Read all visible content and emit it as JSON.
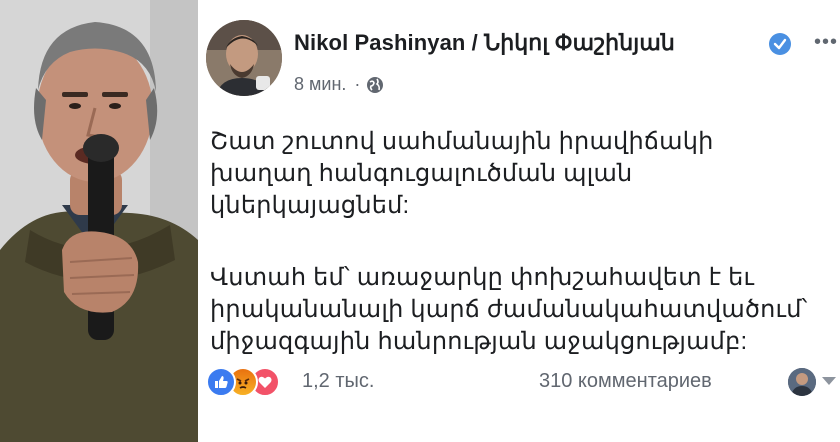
{
  "post": {
    "author": "Nikol Pashinyan / Նիկոլ Փաշինյան",
    "time": "8 мин.",
    "separator": "·",
    "menu": "•••",
    "paragraph1": [
      "Շատ շուտով սահմանային իրավիճակի",
      "խաղաղ հանգուցալուծման պլան",
      "կներկայացնեմ:"
    ],
    "paragraph2": [
      "Վստահ եմ՝ առաջարկը փոխշահավետ է եւ",
      "իրականանալի կարճ ժամանակահատվածում՝",
      "միջազգային հանրության աջակցությամբ:"
    ],
    "reactions_count": "1,2 тыс.",
    "comments_count": "310 комментариев"
  },
  "icons": {
    "verified": "verified-badge-icon",
    "audience": "globe-icon",
    "reactions": [
      "like-icon",
      "angry-icon",
      "love-icon"
    ]
  },
  "colors": {
    "verified": "#4a90e2",
    "like": "#3b7bf0",
    "love": "#f25268",
    "angry": "#e9710f",
    "meta_text": "#616770"
  }
}
